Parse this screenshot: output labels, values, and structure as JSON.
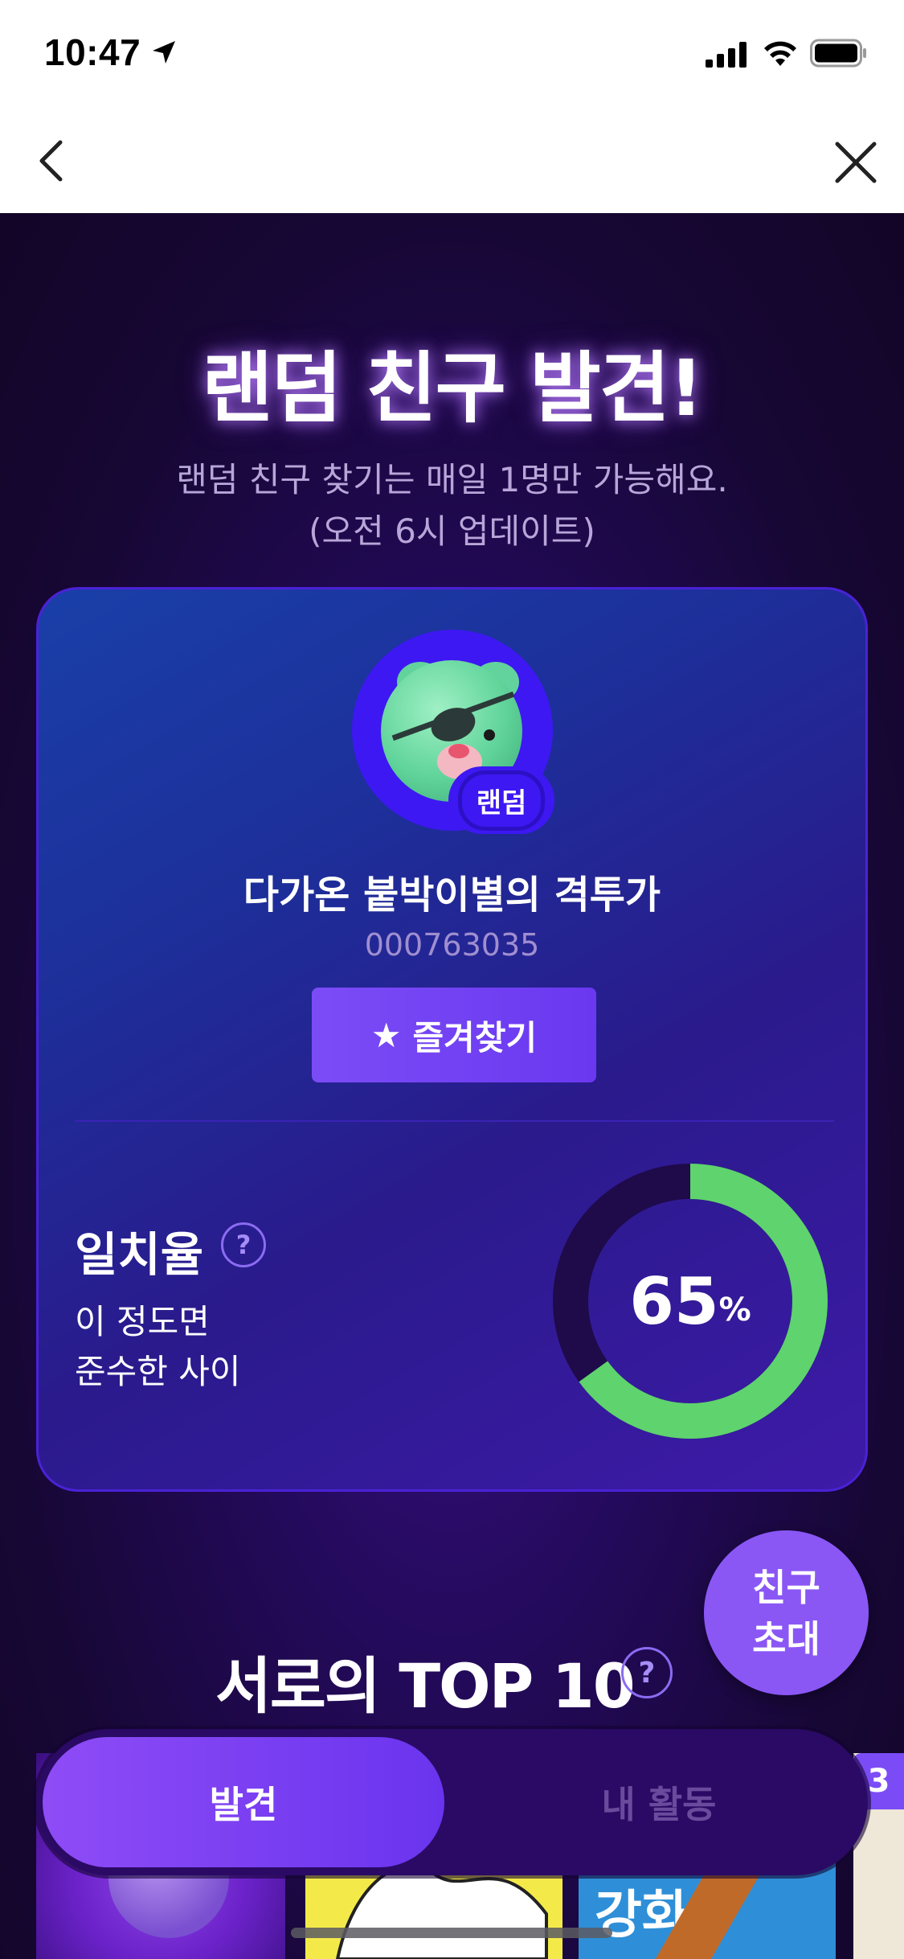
{
  "status_bar": {
    "time": "10:47"
  },
  "header": {
    "title": "랜덤 친구 발견!",
    "subtitle_line1": "랜덤 친구 찾기는 매일 1명만 가능해요.",
    "subtitle_line2": "(오전 6시 업데이트)"
  },
  "profile": {
    "badge": "랜덤",
    "name": "다가온 붙박이별의 격투가",
    "id": "000763035",
    "favorite_label": "즐겨찾기"
  },
  "match": {
    "title": "일치율",
    "help": "?",
    "desc_line1": "이 정도면",
    "desc_line2": "준수한 사이",
    "percent": 65,
    "percent_text": "65",
    "percent_sign": "%",
    "ring_color": "#5ed36e",
    "track_color": "#1f0a4a"
  },
  "invite": {
    "line1": "친구",
    "line2": "초대"
  },
  "top10": {
    "title": "서로의 TOP 10",
    "help": "?"
  },
  "thumbnails": {
    "thumb3_text": "강화",
    "badge_count": "3"
  },
  "tabs": {
    "discover": "발견",
    "activity": "내 활동"
  }
}
